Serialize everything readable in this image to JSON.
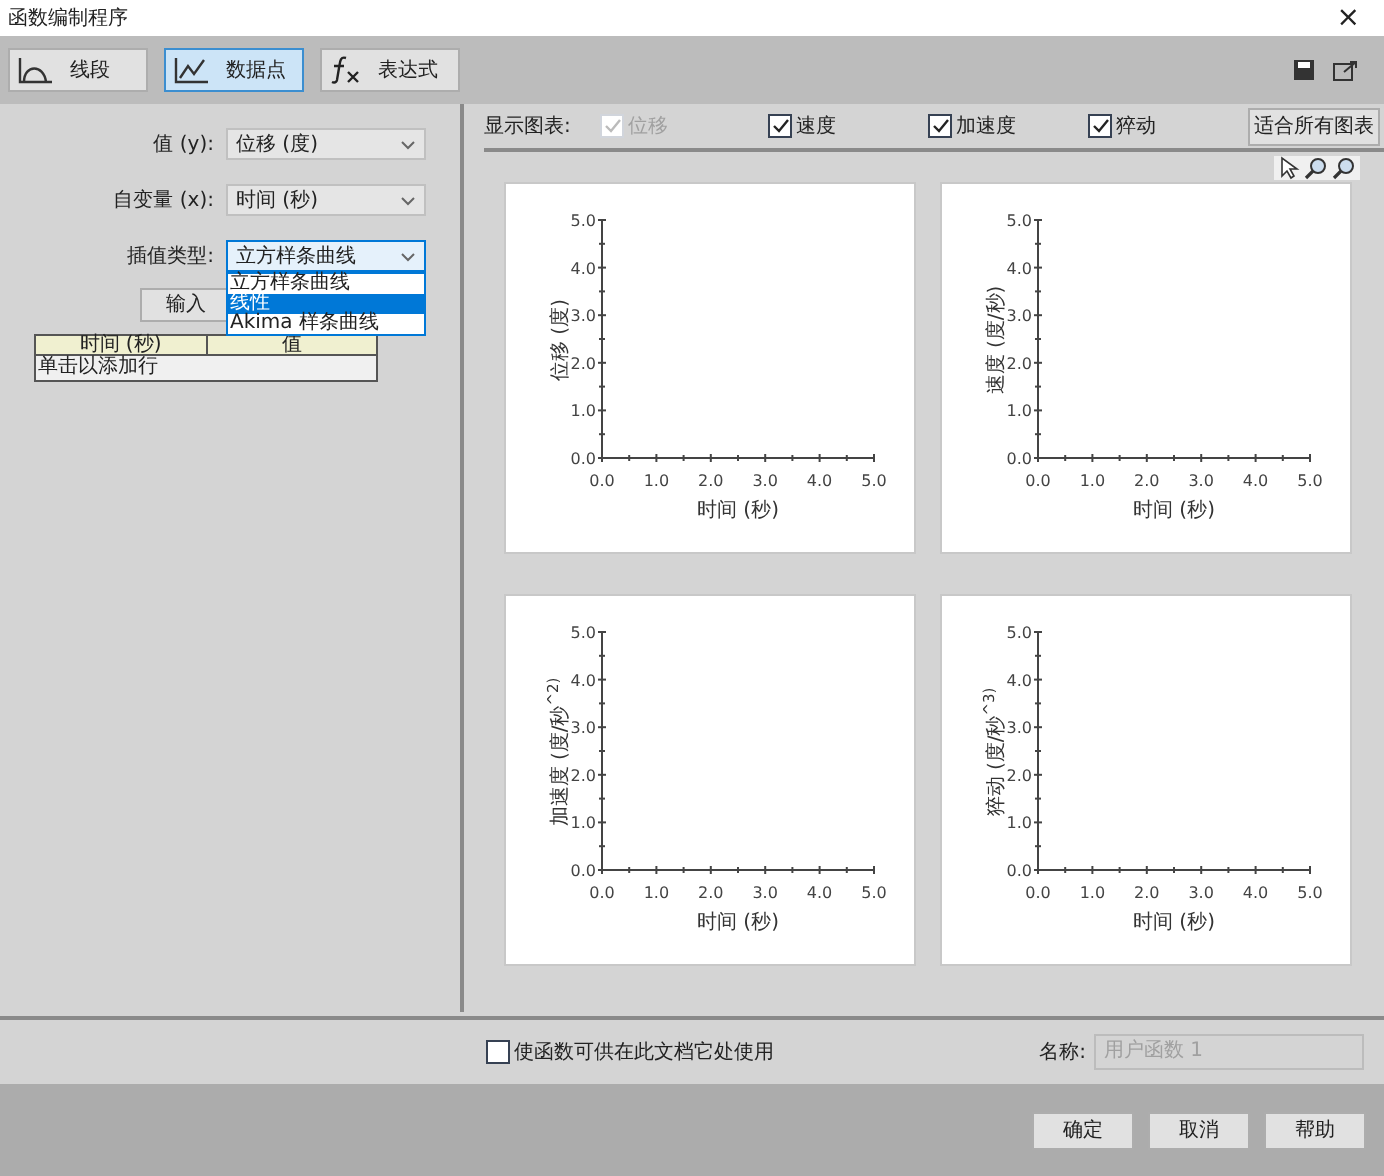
{
  "window": {
    "title": "函数编制程序",
    "close": "×"
  },
  "mode_tabs": [
    {
      "label": "线段",
      "selected": false
    },
    {
      "label": "数据点",
      "selected": true
    },
    {
      "label": "表达式",
      "selected": false
    }
  ],
  "form": {
    "fields": [
      {
        "label": "值 (y):",
        "value": "位移 (度)"
      },
      {
        "label": "自变量 (x):",
        "value": "时间 (秒)"
      },
      {
        "label": "插值类型:",
        "value": "立方样条曲线",
        "expanded": true
      }
    ],
    "dropdown_options": [
      {
        "label": "立方样条曲线",
        "selected": false
      },
      {
        "label": "线性",
        "selected": true
      },
      {
        "label": "Akima 样条曲线",
        "selected": false
      }
    ],
    "input_button": "输入"
  },
  "table": {
    "columns": [
      "时间 (秒)",
      "值"
    ],
    "rows": [
      [
        "单击以添加行"
      ]
    ]
  },
  "show_charts": {
    "label": "显示图表:",
    "options": [
      {
        "label": "位移",
        "checked": true,
        "disabled": true
      },
      {
        "label": "速度",
        "checked": true,
        "disabled": false
      },
      {
        "label": "加速度",
        "checked": true,
        "disabled": false
      },
      {
        "label": "猝动",
        "checked": true,
        "disabled": false
      }
    ],
    "fit_button": "适合所有图表"
  },
  "charts": [
    {
      "chart_data": {
        "type": "line",
        "xlabel": "时间 (秒)",
        "ylabel": "位移 (度)",
        "xlim": [
          0,
          5
        ],
        "ylim": [
          0,
          5
        ],
        "xticks": [
          {
            "value": 0,
            "label": "0.0"
          },
          {
            "value": 1,
            "label": "1.0"
          },
          {
            "value": 2,
            "label": "2.0"
          },
          {
            "value": 3,
            "label": "3.0"
          },
          {
            "value": 4,
            "label": "4.0"
          },
          {
            "value": 5,
            "label": "5.0"
          }
        ],
        "yticks": [
          {
            "value": 0,
            "label": "0.0"
          },
          {
            "value": 1,
            "label": "1.0"
          },
          {
            "value": 2,
            "label": "2.0"
          },
          {
            "value": 3,
            "label": "3.0"
          },
          {
            "value": 4,
            "label": "4.0"
          },
          {
            "value": 5,
            "label": "5.0"
          }
        ]
      }
    },
    {
      "chart_data": {
        "type": "line",
        "xlabel": "时间 (秒)",
        "ylabel": "速度 (度/秒)",
        "xlim": [
          0,
          5
        ],
        "ylim": [
          0,
          5
        ],
        "xticks": [
          {
            "value": 0,
            "label": "0.0"
          },
          {
            "value": 1,
            "label": "1.0"
          },
          {
            "value": 2,
            "label": "2.0"
          },
          {
            "value": 3,
            "label": "3.0"
          },
          {
            "value": 4,
            "label": "4.0"
          },
          {
            "value": 5,
            "label": "5.0"
          }
        ],
        "yticks": [
          {
            "value": 0,
            "label": "0.0"
          },
          {
            "value": 1,
            "label": "1.0"
          },
          {
            "value": 2,
            "label": "2.0"
          },
          {
            "value": 3,
            "label": "3.0"
          },
          {
            "value": 4,
            "label": "4.0"
          },
          {
            "value": 5,
            "label": "5.0"
          }
        ]
      }
    },
    {
      "chart_data": {
        "type": "line",
        "xlabel": "时间 (秒)",
        "ylabel": "加速度 (度/秒$^{^2)}$",
        "xlim": [
          0,
          5
        ],
        "ylim": [
          0,
          5
        ],
        "xticks": [
          {
            "value": 0,
            "label": "0.0"
          },
          {
            "value": 1,
            "label": "1.0"
          },
          {
            "value": 2,
            "label": "2.0"
          },
          {
            "value": 3,
            "label": "3.0"
          },
          {
            "value": 4,
            "label": "4.0"
          },
          {
            "value": 5,
            "label": "5.0"
          }
        ],
        "yticks": [
          {
            "value": 0,
            "label": "0.0"
          },
          {
            "value": 1,
            "label": "1.0"
          },
          {
            "value": 2,
            "label": "2.0"
          },
          {
            "value": 3,
            "label": "3.0"
          },
          {
            "value": 4,
            "label": "4.0"
          },
          {
            "value": 5,
            "label": "5.0"
          }
        ]
      }
    },
    {
      "chart_data": {
        "type": "line",
        "xlabel": "时间 (秒)",
        "ylabel": "猝动 (度/秒$^{^3)}$",
        "xlim": [
          0,
          5
        ],
        "ylim": [
          0,
          5
        ],
        "xticks": [
          {
            "value": 0,
            "label": "0.0"
          },
          {
            "value": 1,
            "label": "1.0"
          },
          {
            "value": 2,
            "label": "2.0"
          },
          {
            "value": 3,
            "label": "3.0"
          },
          {
            "value": 4,
            "label": "4.0"
          },
          {
            "value": 5,
            "label": "5.0"
          }
        ],
        "yticks": [
          {
            "value": 0,
            "label": "0.0"
          },
          {
            "value": 1,
            "label": "1.0"
          },
          {
            "value": 2,
            "label": "2.0"
          },
          {
            "value": 3,
            "label": "3.0"
          },
          {
            "value": 4,
            "label": "4.0"
          },
          {
            "value": 5,
            "label": "5.0"
          }
        ]
      }
    }
  ],
  "footer": {
    "share_checkbox": {
      "label": "使函数可供在此文档它处使用",
      "checked": false
    },
    "name_label": "名称:",
    "name_field": {
      "value": "用户函数 1",
      "disabled": true
    },
    "buttons": [
      "确定",
      "取消",
      "帮助"
    ]
  }
}
